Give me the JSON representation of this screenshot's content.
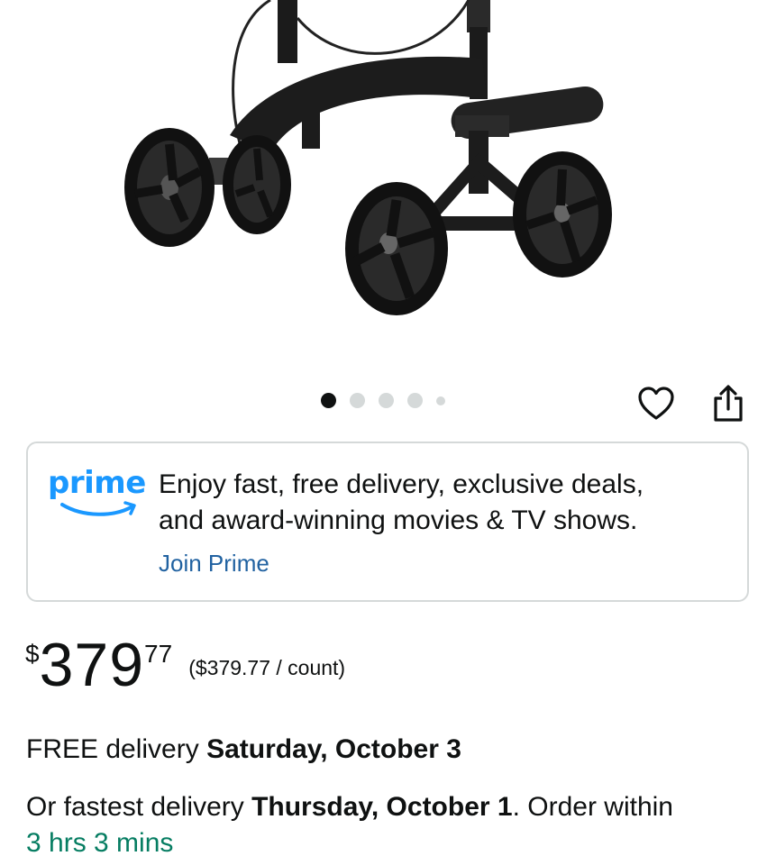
{
  "product": {
    "image_icon": "knee-scooter-image",
    "carousel": {
      "total": 5,
      "active_index": 0
    }
  },
  "actions": {
    "wishlist_icon": "heart-icon",
    "share_icon": "share-icon"
  },
  "prime": {
    "logo_text": "prime",
    "message_line1": "Enjoy fast, free delivery, exclusive deals,",
    "message_line2": "and award-winning movies & TV shows.",
    "cta_label": "Join Prime",
    "brand_color": "#1a98ff",
    "link_color": "#2162a1"
  },
  "price": {
    "symbol": "$",
    "whole": "379",
    "fraction": "77",
    "unit_price": "($379.77 / count)"
  },
  "delivery": {
    "free_prefix": "FREE delivery ",
    "free_date": "Saturday, October 3",
    "fast_prefix": "Or fastest delivery ",
    "fast_date": "Thursday, October 1",
    "fast_suffix": ". Order within",
    "countdown": "3 hrs 3 mins",
    "countdown_color": "#067d62"
  }
}
